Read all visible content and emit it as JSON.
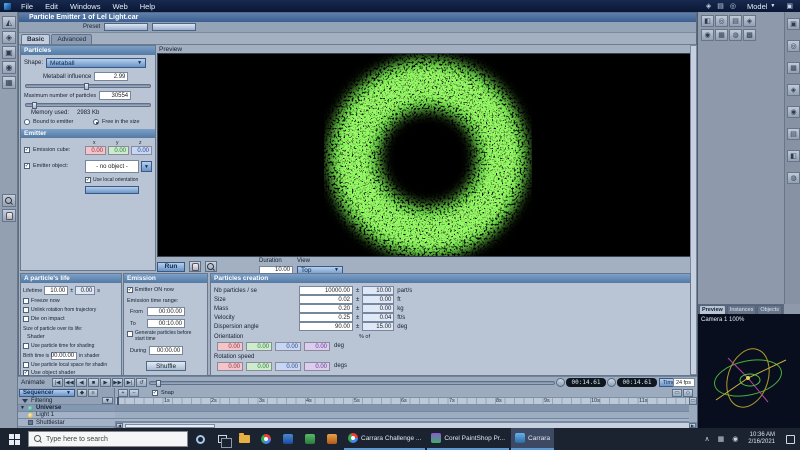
{
  "menu": {
    "items": [
      "File",
      "Edit",
      "Windows",
      "Web",
      "Help"
    ],
    "mode_label": "Model"
  },
  "dialog": {
    "title": "Particle Emitter 1 of Lel Light.car",
    "preset_label": "Preset",
    "tabs": [
      "Basic",
      "Advanced"
    ]
  },
  "particles": {
    "header": "Particles",
    "shape_label": "Shape:",
    "shape_value": "Metaball",
    "influence_label": "Metaball influence",
    "influence_value": "2.99",
    "max_particles_label": "Maximum number of particles",
    "max_particles_value": "30554",
    "memory_label": "Memory used:",
    "memory_value": "2983 Kb",
    "bound_option": "Bound to emitter",
    "free_option": "Free in the size"
  },
  "emitter": {
    "header": "Emitter",
    "emission_cube_label": "Emission cube:",
    "axis_labels": [
      "x",
      "y",
      "z"
    ],
    "cube_values": [
      "0.00",
      "0.00",
      "0.00"
    ],
    "object_label": "Emitter object:",
    "object_value": "- no object -",
    "local_orientation_label": "Use local orientation"
  },
  "preview": {
    "label": "Preview",
    "run_label": "Run",
    "duration_label": "Duration",
    "duration_value": "10.00",
    "view_label": "View",
    "view_value": "Top"
  },
  "life": {
    "header": "A particle's life",
    "lifetime_label": "Lifetime",
    "lifetime_value": "10.00",
    "lifetime_variance": "0.00",
    "lifetime_unit": "s",
    "freeze_label": "Freeze now",
    "unlink_label": "Unlink rotation from trajectory",
    "die_label": "Die on impact",
    "size_label": "Size of particle over its life:",
    "shader_label": "Shader",
    "particle_time_label": "Use particle time for shading",
    "birth_label": "Birth time is",
    "birth_value": "00.00.00",
    "birth_suffix": "in shader",
    "local_space_label": "Use particle local space for shadin",
    "object_shader_label": "Use object shader"
  },
  "emission": {
    "header": "Emission",
    "emitter_on_label": "Emitter ON now",
    "range_label": "Emission time range:",
    "from_label": "From",
    "from_value": "00:00.00",
    "to_label": "To",
    "to_value": "00:10.00",
    "generate_label": "Generate particles before start time",
    "during_label": "During",
    "during_value": "00:00.00",
    "shuffle_label": "Shuffle"
  },
  "creation": {
    "header": "Particles creation",
    "pm": "±",
    "rows": [
      {
        "label": "Nb particles / se",
        "value": "10000.00",
        "variance": "10.00",
        "unit": "part/s"
      },
      {
        "label": "Size",
        "value": "0.02",
        "variance": "0.00",
        "unit": "ft"
      },
      {
        "label": "Mass",
        "value": "0.20",
        "variance": "0.00",
        "unit": "kg"
      },
      {
        "label": "Velocity",
        "value": "0.25",
        "variance": "0.04",
        "unit": "ft/s"
      },
      {
        "label": "Dispersion angle",
        "value": "90.00",
        "variance": "15.00",
        "unit": "deg"
      }
    ],
    "orientation_label": "Orientation",
    "percent_label": "% of",
    "orientation_values": [
      "0.00",
      "0.00",
      "0.00",
      "0.00"
    ],
    "orientation_unit": "deg",
    "rotation_label": "Rotation speed",
    "rotation_values": [
      "0.00",
      "0.00",
      "0.00",
      "0.00"
    ],
    "rotation_unit": "degs"
  },
  "transport": {
    "animate_label": "Animate",
    "time_a": "00:14.61",
    "time_b": "00:14.61",
    "mode": "Time",
    "fps": "24 fps"
  },
  "sequencer": {
    "button_label": "Sequencer",
    "filtering_label": "Filtering",
    "snap_label": "Snap",
    "ticks": [
      "1s",
      "2s",
      "3s",
      "4s",
      "5s",
      "6s",
      "7s",
      "8s",
      "9s",
      "10s",
      "11s"
    ],
    "tracks": [
      "Universe",
      "Light 1",
      "Shuttlestar"
    ]
  },
  "right_panel": {
    "tabs": [
      "Preview",
      "Instances",
      "Objects"
    ],
    "camera_label": "Camera 1 100%"
  },
  "taskbar": {
    "search_text": "Type here to search",
    "apps": [
      "Carrara Challenge ...",
      "Corel PaintShop Pr...",
      "Carrara"
    ],
    "clock_time": "10:36 AM",
    "clock_date": "2/16/2021"
  },
  "icons": {
    "check": "✓",
    "caret_down": "▼",
    "caret_up": "▲",
    "tray_caret": "∧",
    "transport": [
      "|◀",
      "◀◀",
      "◀",
      "■",
      "▶",
      "▶▶",
      "▶|",
      "↺"
    ]
  },
  "glyphs": {
    "left_tools": [
      "◭",
      "◈",
      "▣",
      "◉",
      "▦"
    ],
    "menu_icons": [
      "◈",
      "▤",
      "◎"
    ],
    "fullscreen": "▣",
    "top_tools": [
      "◧",
      "◎",
      "▤",
      "◈",
      "◉",
      "▦",
      "◍",
      "▩"
    ],
    "strip_tools": [
      "▣",
      "◎",
      "▦",
      "◈",
      "◉",
      "▤",
      "◧",
      "◍"
    ],
    "seq_icons": [
      "◆",
      "≡"
    ],
    "zoom_icons": [
      "+",
      "−"
    ],
    "corner": "▭",
    "corner2": "◇",
    "tray_icons": [
      "▦",
      "◉"
    ]
  }
}
